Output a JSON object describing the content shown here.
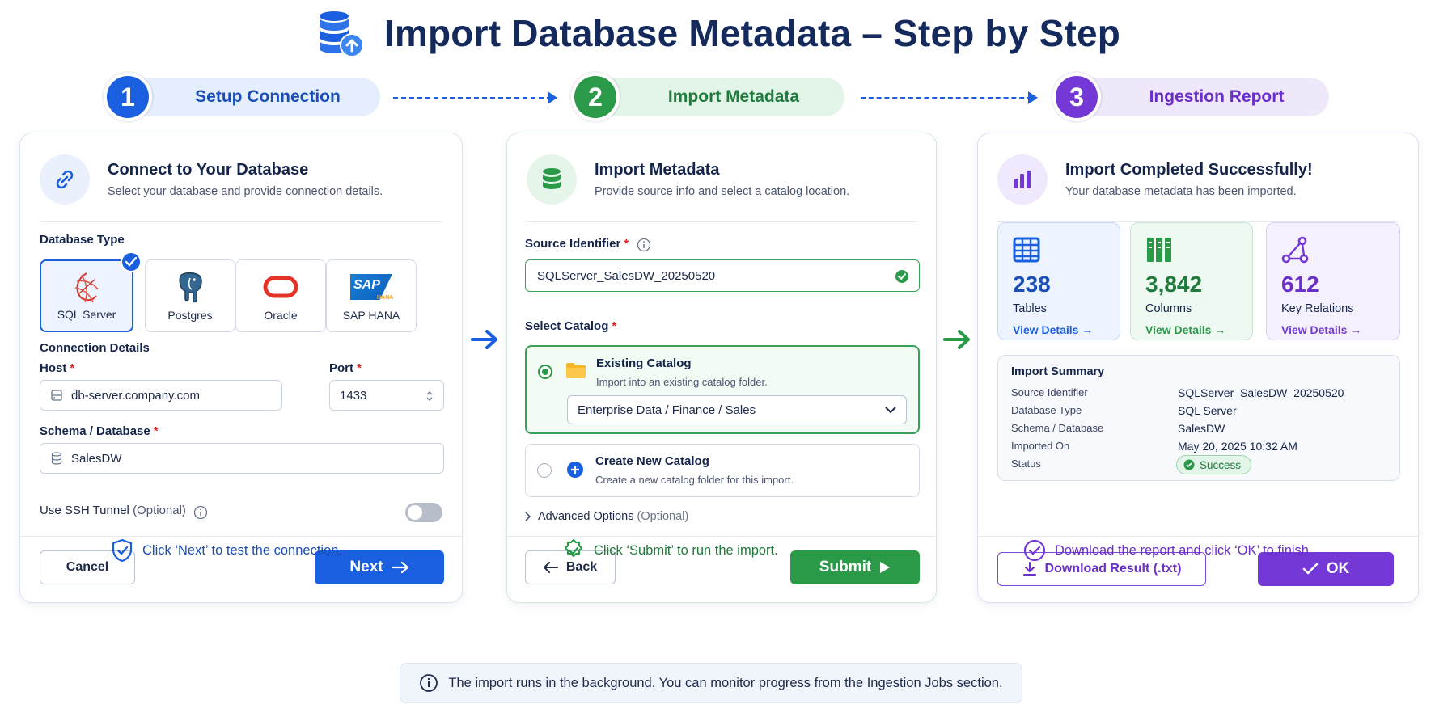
{
  "title": "Import Database Metadata – Step by Step",
  "steps": [
    {
      "number": "1",
      "label": "Setup Connection"
    },
    {
      "number": "2",
      "label": "Import Metadata"
    },
    {
      "number": "3",
      "label": "Ingestion Report"
    }
  ],
  "step1": {
    "title": "Connect to Your Database",
    "subtitle": "Select your database and provide connection details.",
    "db_type_label": "Database Type",
    "db_types": [
      {
        "label": "SQL Server",
        "selected": true,
        "icon": "sql-server-icon"
      },
      {
        "label": "Postgres",
        "selected": false,
        "icon": "postgres-elephant-icon"
      },
      {
        "label": "Oracle",
        "selected": false,
        "icon": "oracle-icon"
      },
      {
        "label": "SAP HANA",
        "selected": false,
        "icon": "sap-hana-icon"
      }
    ],
    "sap_logo_text": "SAP",
    "sap_logo_sub": "HANA",
    "connection_label": "Connection Details",
    "host_label": "Host",
    "host_value": "db-server.company.com",
    "port_label": "Port",
    "port_value": "1433",
    "schema_label": "Schema / Database",
    "schema_value": "SalesDW",
    "ssh_label": "Use SSH Tunnel",
    "ssh_optional": "(Optional)",
    "ssh_enabled": false,
    "cancel_label": "Cancel",
    "next_label": "Next",
    "hint": "Click ‘Next’ to test the connection."
  },
  "step2": {
    "title": "Import Metadata",
    "subtitle": "Provide source info and select a catalog location.",
    "source_label": "Source Identifier",
    "source_value": "SQLServer_SalesDW_20250520",
    "catalog_label": "Select Catalog",
    "existing_title": "Existing Catalog",
    "existing_sub": "Import into an existing catalog folder.",
    "existing_value": "Enterprise Data / Finance / Sales",
    "new_title": "Create New Catalog",
    "new_sub": "Create a new catalog folder for this import.",
    "advanced_label": "Advanced Options",
    "advanced_optional": "(Optional)",
    "back_label": "Back",
    "submit_label": "Submit",
    "hint": "Click ‘Submit’ to run the import."
  },
  "step3": {
    "title": "Import Completed Successfully!",
    "subtitle": "Your database metadata has been imported.",
    "stats": [
      {
        "value": "238",
        "label": "Tables",
        "link": "View Details →",
        "color": "#1a5fe0"
      },
      {
        "value": "3,842",
        "label": "Columns",
        "link": "View Details →",
        "color": "#2a9a48"
      },
      {
        "value": "612",
        "label": "Key Relations",
        "link": "View Details →",
        "color": "#7438d6"
      }
    ],
    "summary_title": "Import Summary",
    "summary": [
      {
        "key": "Source Identifier",
        "value": "SQLServer_SalesDW_20250520"
      },
      {
        "key": "Database Type",
        "value": "SQL Server"
      },
      {
        "key": "Schema / Database",
        "value": "SalesDW"
      },
      {
        "key": "Imported On",
        "value": "May 20, 2025 10:32 AM"
      }
    ],
    "status_key": "Status",
    "status_value": "Success",
    "download_label": "Download Result (.txt)",
    "ok_label": "OK",
    "hint": "Download the report and click ‘OK’ to finish."
  },
  "notice": "The import runs in the background. You can monitor progress from the Ingestion Jobs section.",
  "colors": {
    "blue": "#1a5fe0",
    "green": "#2a9a48",
    "purple": "#7438d6",
    "navy": "#142a5c"
  }
}
